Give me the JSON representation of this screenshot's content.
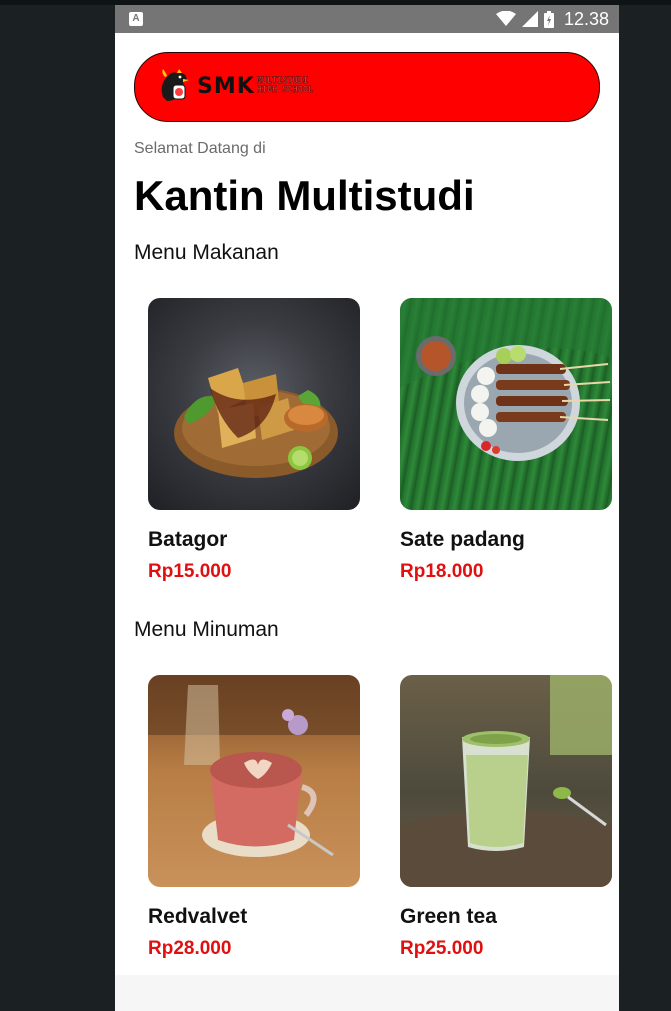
{
  "status_bar": {
    "left_icon": "A",
    "time": "12.38",
    "icons": [
      "wifi-icon",
      "signal-icon",
      "battery-icon"
    ]
  },
  "banner": {
    "logo_text": "SMK",
    "logo_subtitle_1": "MULTISTUDI",
    "logo_subtitle_2": "HIGH SCHOOL",
    "background_color": "#ff0000"
  },
  "header": {
    "welcome": "Selamat Datang di",
    "title": "Kantin Multistudi"
  },
  "sections": [
    {
      "label": "Menu Makanan",
      "items": [
        {
          "name": "Batagor",
          "price": "Rp15.000",
          "image": "batagor-photo"
        },
        {
          "name": "Sate padang",
          "price": "Rp18.000",
          "image": "sate-padang-photo"
        }
      ]
    },
    {
      "label": "Menu Minuman",
      "items": [
        {
          "name": "Redvalvet",
          "price": "Rp28.000",
          "image": "red-velvet-photo"
        },
        {
          "name": "Green tea",
          "price": "Rp25.000",
          "image": "green-tea-photo"
        }
      ]
    }
  ],
  "colors": {
    "price": "#e01010",
    "status_bar": "#757575"
  }
}
